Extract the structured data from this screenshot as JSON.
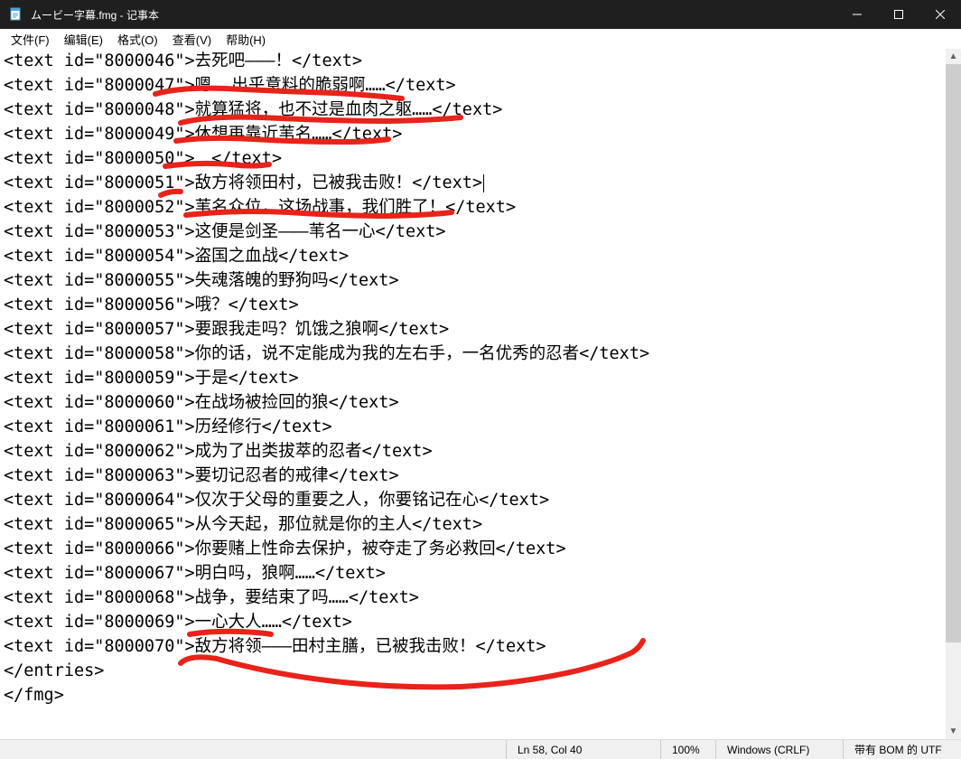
{
  "window": {
    "title": "ムービー字幕.fmg - 记事本"
  },
  "menu": {
    "file": "文件(F)",
    "edit": "编辑(E)",
    "format": "格式(O)",
    "view": "查看(V)",
    "help": "帮助(H)"
  },
  "lines": [
    "<text id=\"8000046\">去死吧———！</text>",
    "<text id=\"8000047\">嗯……出乎意料的脆弱啊……</text>",
    "<text id=\"8000048\">就算猛将，也不过是血肉之躯……</text>",
    "<text id=\"8000049\">休想再靠近苇名……</text>",
    "<text id=\"8000050\">　</text>",
    "<text id=\"8000051\">敌方将领田村，已被我击败！</text>",
    "<text id=\"8000052\">苇名众位，这场战事，我们胜了！</text>",
    "<text id=\"8000053\">这便是剑圣———苇名一心</text>",
    "<text id=\"8000054\">盗国之血战</text>",
    "<text id=\"8000055\">失魂落魄的野狗吗</text>",
    "<text id=\"8000056\">哦？</text>",
    "<text id=\"8000057\">要跟我走吗？饥饿之狼啊</text>",
    "<text id=\"8000058\">你的话，说不定能成为我的左右手，一名优秀的忍者</text>",
    "<text id=\"8000059\">于是</text>",
    "<text id=\"8000060\">在战场被捡回的狼</text>",
    "<text id=\"8000061\">历经修行</text>",
    "<text id=\"8000062\">成为了出类拔萃的忍者</text>",
    "<text id=\"8000063\">要切记忍者的戒律</text>",
    "<text id=\"8000064\">仅次于父母的重要之人，你要铭记在心</text>",
    "<text id=\"8000065\">从今天起，那位就是你的主人</text>",
    "<text id=\"8000066\">你要赌上性命去保护，被夺走了务必救回</text>",
    "<text id=\"8000067\">明白吗，狼啊……</text>",
    "<text id=\"8000068\">战争，要结束了吗……</text>",
    "<text id=\"8000069\">一心大人……</text>",
    "<text id=\"8000070\">敌方将领———田村主膳，已被我击败！</text>",
    "</entries>",
    "</fmg>"
  ],
  "caret_line_index": 5,
  "statusbar": {
    "position": "Ln 58,  Col 40",
    "zoom": "100%",
    "eol": "Windows (CRLF)",
    "encoding": "带有 BOM 的 UTF"
  }
}
